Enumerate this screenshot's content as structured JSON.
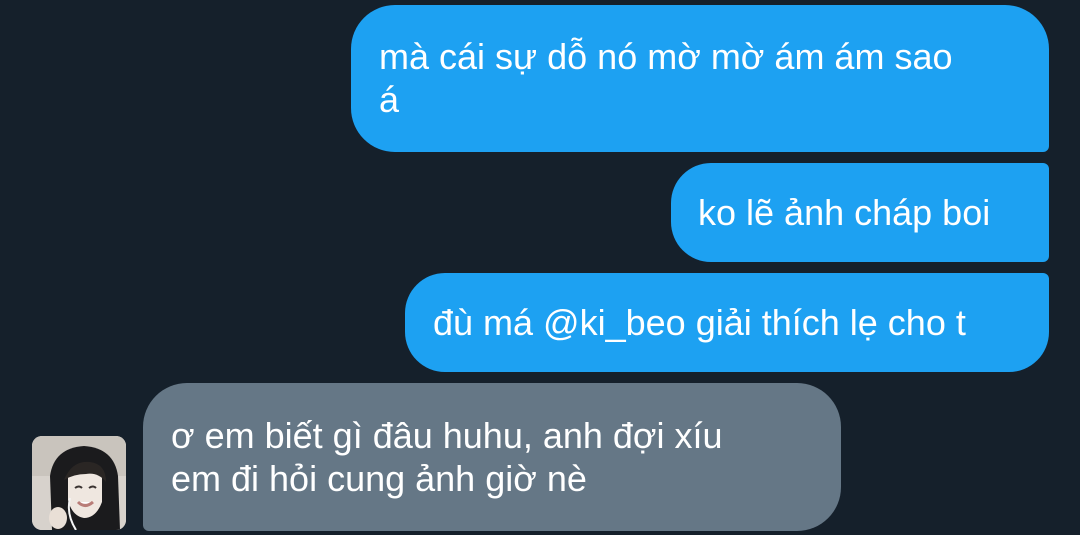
{
  "chat": {
    "messages": [
      {
        "sender": "self",
        "text": "mà cái sự dỗ nó mờ mờ ám ám sao\ná"
      },
      {
        "sender": "self",
        "text": "ko lẽ ảnh cháp boi"
      },
      {
        "sender": "self",
        "text": "đù má @ki_beo giải thích lẹ cho t"
      },
      {
        "sender": "other",
        "text": "ơ em biết gì đâu huhu, anh đợi xíu\nem đi hỏi cung ảnh giờ nè"
      }
    ]
  },
  "colors": {
    "background": "#15202b",
    "sent_bubble": "#1da1f2",
    "received_bubble": "#657786",
    "text": "#ffffff"
  },
  "icons": {
    "avatar": "user-photo-avatar"
  }
}
